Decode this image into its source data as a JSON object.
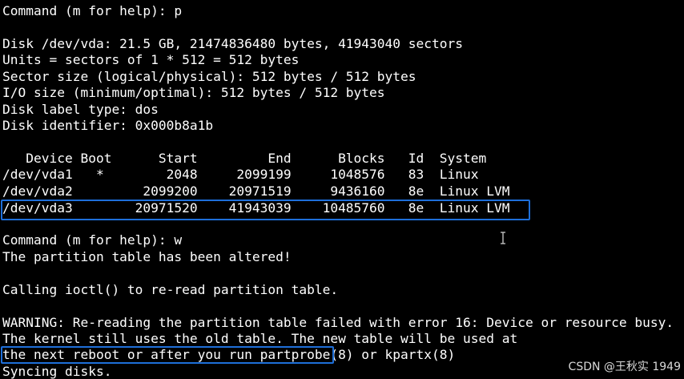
{
  "terminal": {
    "lines": [
      "Command (m for help): p",
      "",
      "Disk /dev/vda: 21.5 GB, 21474836480 bytes, 41943040 sectors",
      "Units = sectors of 1 * 512 = 512 bytes",
      "Sector size (logical/physical): 512 bytes / 512 bytes",
      "I/O size (minimum/optimal): 512 bytes / 512 bytes",
      "Disk label type: dos",
      "Disk identifier: 0x000b8a1b",
      "",
      "   Device Boot      Start         End      Blocks   Id  System",
      "/dev/vda1   *        2048     2099199     1048576   83  Linux",
      "/dev/vda2         2099200    20971519     9436160   8e  Linux LVM",
      "/dev/vda3        20971520    41943039    10485760   8e  Linux LVM",
      "",
      "Command (m for help): w",
      "The partition table has been altered!",
      "",
      "Calling ioctl() to re-read partition table.",
      "",
      "WARNING: Re-reading the partition table failed with error 16: Device or resource busy.",
      "The kernel still uses the old table. The new table will be used at",
      "the next reboot or after you run partprobe(8) or kpartx(8)",
      "Syncing disks."
    ]
  },
  "watermark": "CSDN @王秋实 1949",
  "colors": {
    "background": "#000000",
    "text": "#ffffff",
    "highlight_box": "#1e6fd9"
  }
}
